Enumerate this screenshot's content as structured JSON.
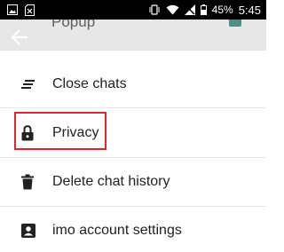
{
  "status_bar": {
    "battery_percent": "45%",
    "time": "5:45",
    "left_icons": [
      "image-icon",
      "sim-card-icon"
    ],
    "right_icons": [
      "vibrate-icon",
      "wifi-icon",
      "no-sim-icon",
      "battery-icon"
    ]
  },
  "header": {
    "title_fragment": "Popup",
    "back_icon": "arrow-back-icon"
  },
  "menu": {
    "items": [
      {
        "label": "Close chats",
        "icon": "close-chats-icon"
      },
      {
        "label": "Privacy",
        "icon": "lock-icon",
        "highlighted": true
      },
      {
        "label": "Delete chat history",
        "icon": "trash-icon"
      },
      {
        "label": "imo account settings",
        "icon": "account-box-icon"
      }
    ]
  },
  "colors": {
    "status_bar": "#000000",
    "header_bg": "#e7e7e7",
    "highlight_border": "#e0262b",
    "text": "#212121"
  }
}
